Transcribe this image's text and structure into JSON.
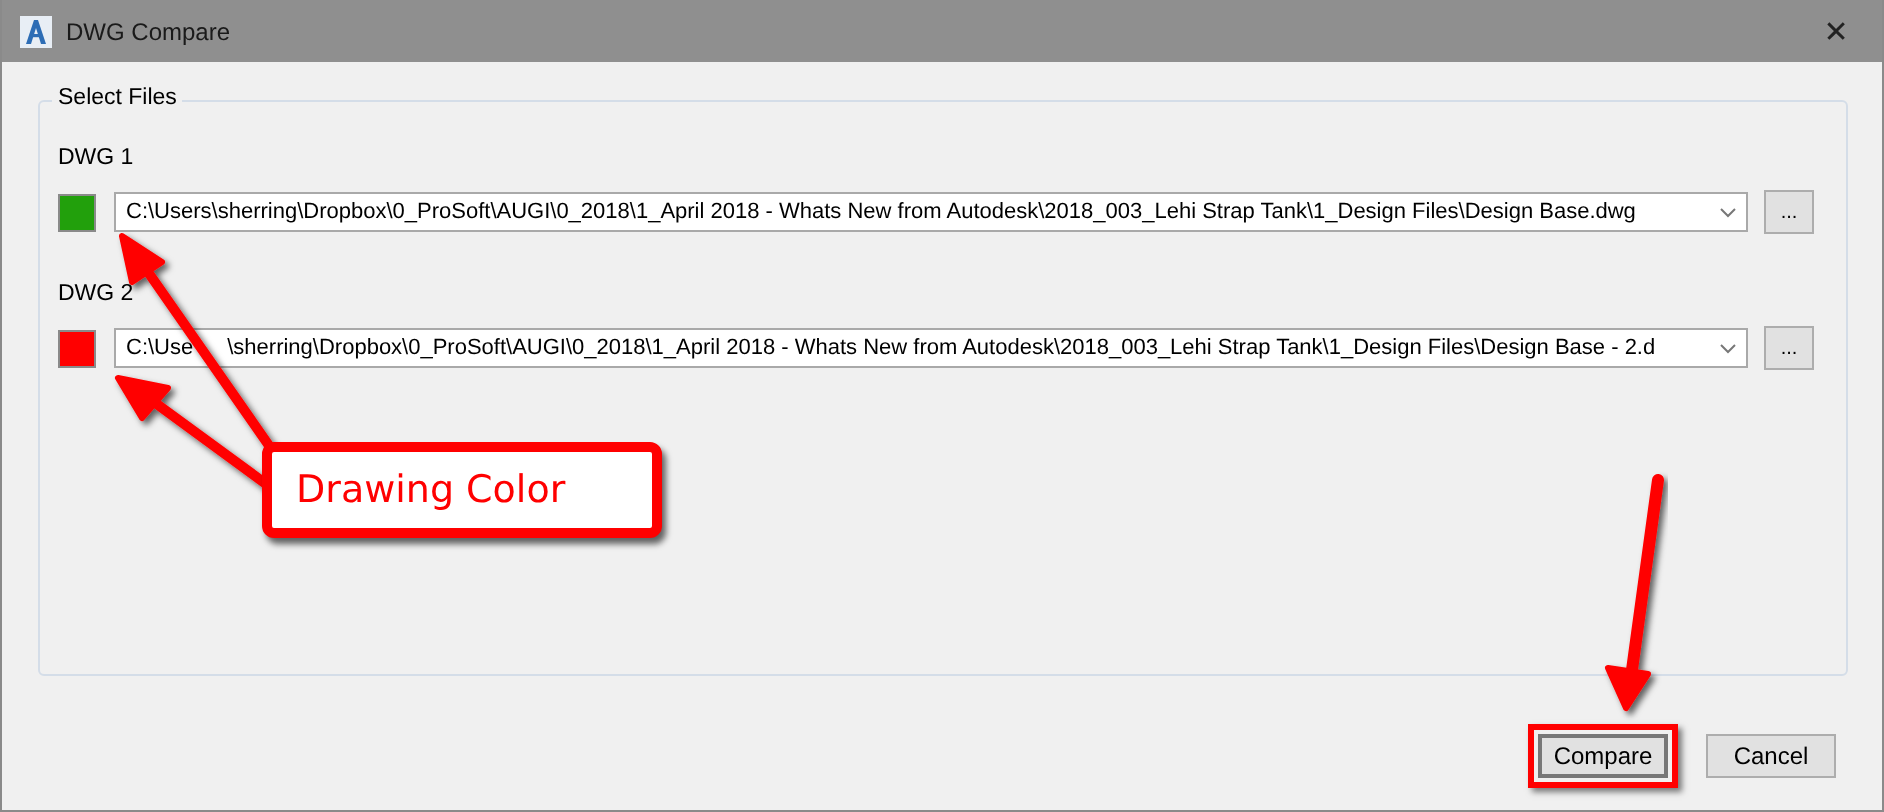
{
  "window": {
    "title": "DWG Compare",
    "close": "✕"
  },
  "group": {
    "legend": "Select Files"
  },
  "files": [
    {
      "label": "DWG 1",
      "color": "#22a00c",
      "path_parts": [
        "C:\\Users\\sherring\\Dropbox\\0_ProSoft\\AUGI\\0_2018\\1_April 2018 - Whats New from Autodesk\\2018_003_Lehi Strap Tank\\1_Design Files\\Design Base.dwg"
      ],
      "browse": "..."
    },
    {
      "label": "DWG 2",
      "color": "#ff0000",
      "path_parts": [
        "C:\\Use",
        "\\sherring\\Dropbox\\0_ProSoft\\AUGI\\0_2018\\1_April 2018 - Whats New from Autodesk\\2018_003_Lehi Strap Tank\\1_Design Files\\Design Base - 2.d"
      ],
      "browse": "..."
    }
  ],
  "callout": {
    "text": "Drawing Color"
  },
  "buttons": [
    {
      "label": "Compare",
      "highlighted": true
    },
    {
      "label": "Cancel",
      "highlighted": false
    }
  ]
}
